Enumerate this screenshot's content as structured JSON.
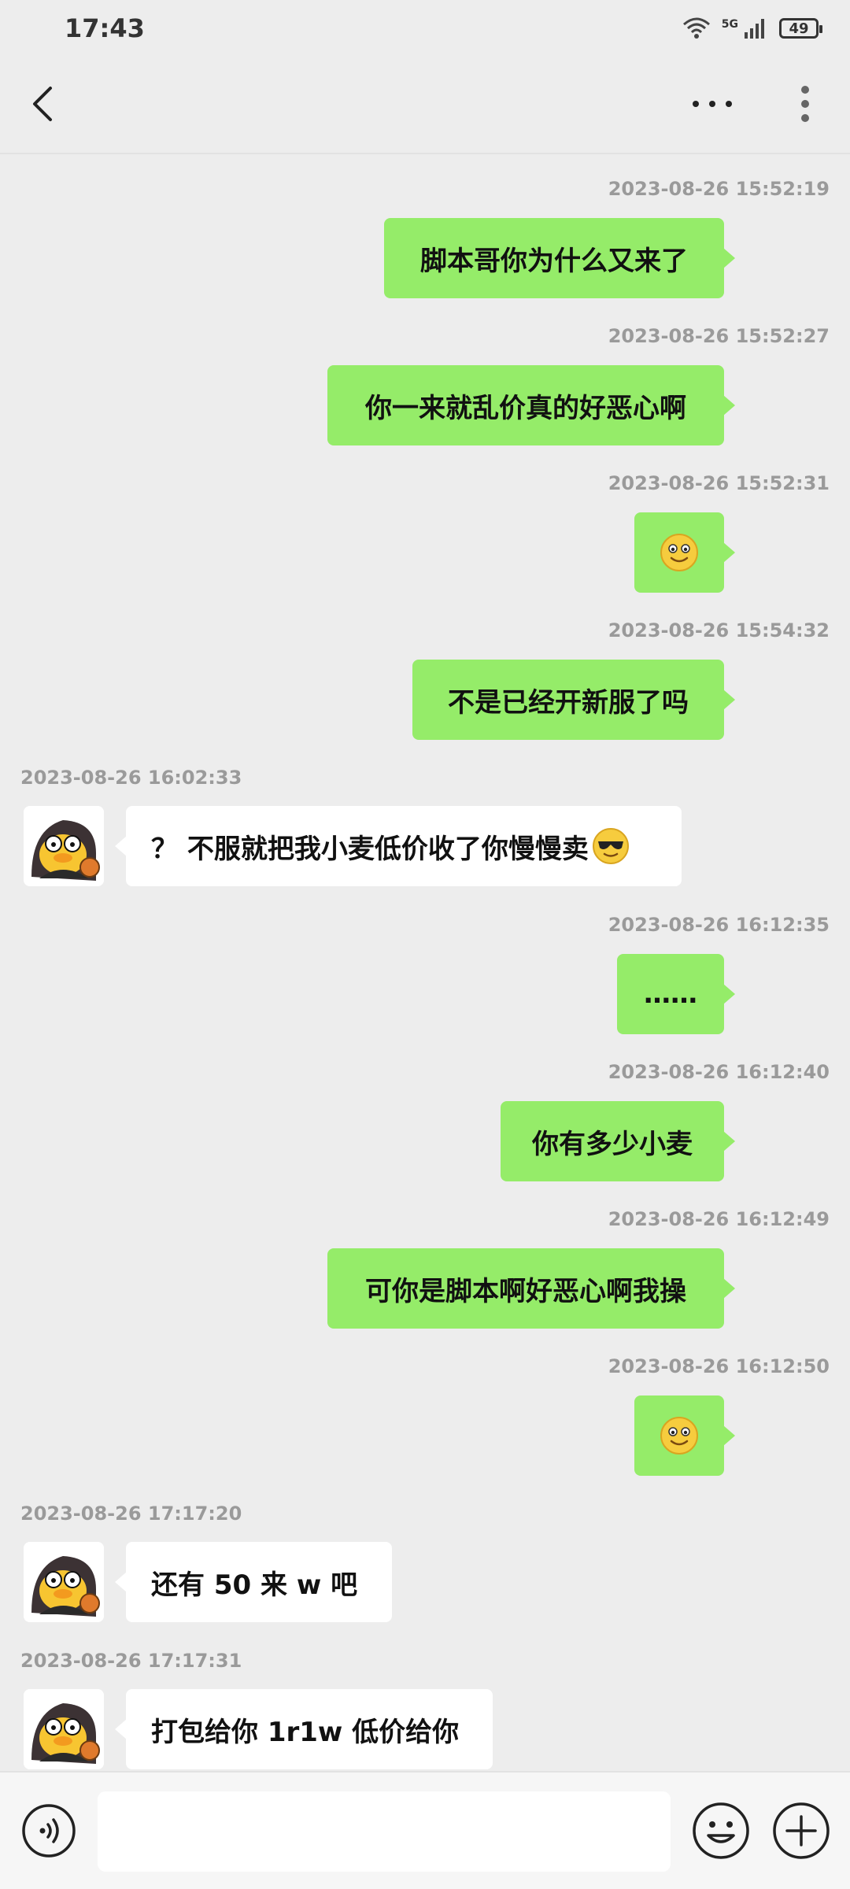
{
  "status_bar": {
    "time": "17:43",
    "network": "5G",
    "battery": "49"
  },
  "header": {
    "back_icon": "chevron-left-icon",
    "more_icon": "more-horizontal-icon",
    "menu_icon": "more-vertical-icon"
  },
  "messages": [
    {
      "timestamp": "2023-08-26 15:52:19",
      "side": "out",
      "text": "脚本哥你为什么又来了"
    },
    {
      "timestamp": "2023-08-26 15:52:27",
      "side": "out",
      "text": "你一来就乱价真的好恶心啊"
    },
    {
      "timestamp": "2023-08-26 15:52:31",
      "side": "out",
      "emoji": "smile-emoji"
    },
    {
      "timestamp": "2023-08-26 15:54:32",
      "side": "out",
      "text": "不是已经开新服了吗"
    },
    {
      "timestamp": "2023-08-26 16:02:33",
      "side": "in",
      "text": "？ 不服就把我小麦低价收了你慢慢卖",
      "emoji": "sunglasses-emoji"
    },
    {
      "timestamp": "2023-08-26 16:12:35",
      "side": "out",
      "text": "……"
    },
    {
      "timestamp": "2023-08-26 16:12:40",
      "side": "out",
      "text": "你有多少小麦"
    },
    {
      "timestamp": "2023-08-26 16:12:49",
      "side": "out",
      "text": "可你是脚本啊好恶心啊我操"
    },
    {
      "timestamp": "2023-08-26 16:12:50",
      "side": "out",
      "emoji": "smile-emoji"
    },
    {
      "timestamp": "2023-08-26 17:17:20",
      "side": "in",
      "text": "还有 50 来 w 吧"
    },
    {
      "timestamp": "2023-08-26 17:17:31",
      "side": "in",
      "text": "打包给你 1r1w 低价给你"
    }
  ],
  "colors": {
    "outgoing_bubble": "#95ec69",
    "incoming_bubble": "#ffffff",
    "background": "#ededed"
  },
  "bottom_bar": {
    "voice_icon": "voice-icon",
    "emoji_icon": "emoji-icon",
    "plus_icon": "plus-icon",
    "input_value": ""
  }
}
